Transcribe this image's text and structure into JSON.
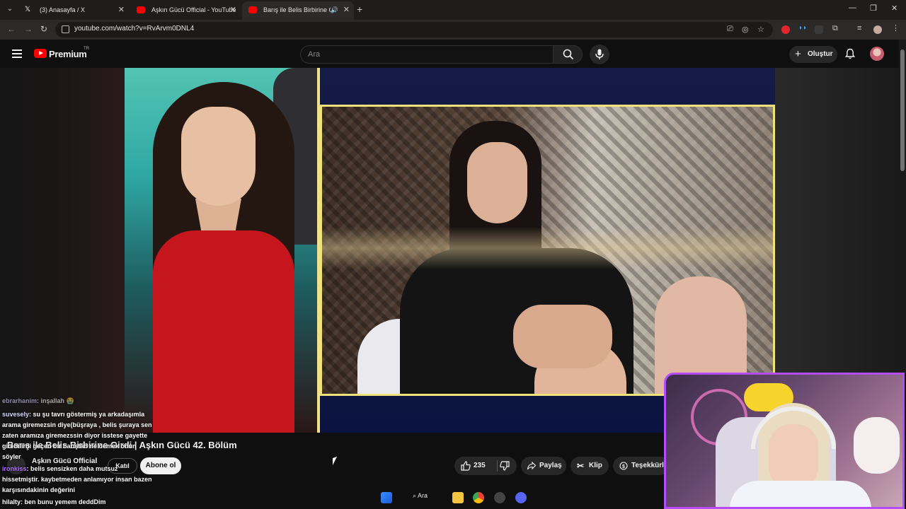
{
  "browser": {
    "tabs": [
      {
        "label": "(3) Anasayfa / X",
        "active": false
      },
      {
        "label": "Aşkın Gücü Official - YouTube",
        "active": false
      },
      {
        "label": "Barış ile Belis Birbirine Girdi",
        "active": true
      }
    ],
    "url": "youtube.com/watch?v=RvArvm0DNL4"
  },
  "youtube": {
    "logo_text": "Premium",
    "region": "TR",
    "search_placeholder": "Ara",
    "create_label": "Oluştur"
  },
  "chat": [
    {
      "user": "ebrarhanim",
      "text": ": inşallah 😭"
    },
    {
      "user": "suvesely",
      "text": ": su şu tavrı göstermiş ya arkadaşımla"
    },
    {
      "user": "",
      "text": "arama giremezsin diye(büşraya , belis şuraya sen"
    },
    {
      "user": "",
      "text": "zaten aramıza giremezssin diyor isstese gayette"
    },
    {
      "user": "",
      "text": "girebilirdi geçen bir barıştan ne demek onun"
    },
    {
      "user": "",
      "text": "söyler"
    },
    {
      "user": "ironkiss",
      "text": ": belis sensizken daha mutsuz"
    },
    {
      "user": "",
      "text": "hissetmiştir. kaybetmeden anlamıyor insan bazen"
    },
    {
      "user": "",
      "text": "karşısındakinin değerini"
    },
    {
      "user": "hilalty",
      "text": ": ben bunu yemem deddDim"
    }
  ],
  "video": {
    "title": "Barış ile Belis Birbirine Girdi | Aşkın Gücü 42. Bölüm",
    "channel": "Aşkın Gücü Official",
    "join_label": "Katıl",
    "subscribe_label": "Abone ol",
    "likes": "235",
    "share_label": "Paylaş",
    "clip_label": "Klip",
    "thanks_label": "Teşekkürler"
  },
  "taskbar": {
    "search_label": "Ara"
  },
  "colors": {
    "youtube_red": "#ff0000",
    "webcam_border": "#b44dff",
    "frame_accent": "#efe27a"
  }
}
